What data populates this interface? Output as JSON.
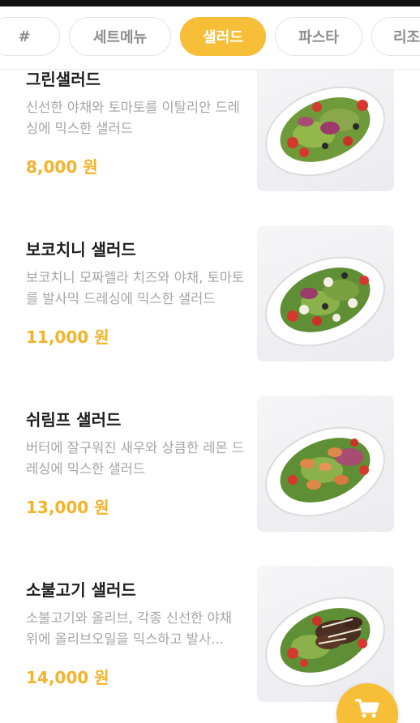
{
  "tabs": [
    {
      "label": "#",
      "active": false
    },
    {
      "label": "세트메뉴",
      "active": false
    },
    {
      "label": "샐러드",
      "active": true
    },
    {
      "label": "파스타",
      "active": false
    },
    {
      "label": "리조또",
      "active": false
    }
  ],
  "menu_items": [
    {
      "name": "그린샐러드",
      "description": "신선한 야채와 토마토를 이탈리안 드레싱에 믹스한 샐러드",
      "price": "8,000 원",
      "image": "green-salad-plate"
    },
    {
      "name": "보코치니 샐러드",
      "description": "보코치니 모짜렐라 치즈와 야채, 토마토를 발사믹 드레싱에 믹스한 샐러드",
      "price": "11,000 원",
      "image": "bocconcini-salad-plate"
    },
    {
      "name": "쉬림프 샐러드",
      "description": "버터에 잘구워진 새우와 상큼한 레몬 드레싱에 믹스한 샐러드",
      "price": "13,000 원",
      "image": "shrimp-salad-plate"
    },
    {
      "name": "소불고기 샐러드",
      "description": "소불고기와 올리브, 각종 신선한 야채 위에 올리브오일을 믹스하고 발사...",
      "price": "14,000 원",
      "image": "bulgogi-salad-plate"
    }
  ],
  "cart_button": {
    "icon": "cart-icon"
  },
  "colors": {
    "accent": "#f7be38",
    "price": "#f4b32a",
    "text": "#1e1e1e",
    "muted": "#a6a6a6"
  }
}
